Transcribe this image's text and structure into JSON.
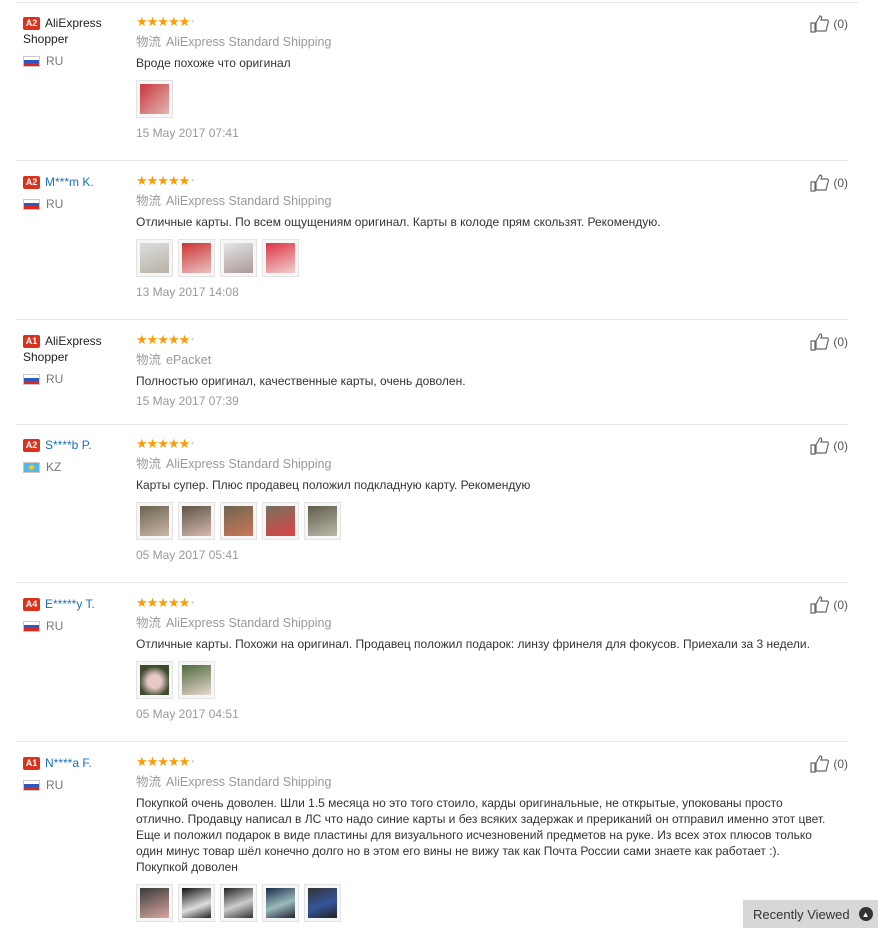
{
  "shipping_label": "物流",
  "recently_viewed": "Recently Viewed",
  "reviews": [
    {
      "badge": "A2",
      "name": "AliExpress Shopper",
      "country": "RU",
      "stars": "★★★★★",
      "shipping": "AliExpress Standard Shipping",
      "text": "Вроде похоже что оригинал",
      "date": "15 May 2017 07:41",
      "helpful": "(0)"
    },
    {
      "badge": "A2",
      "name": "M***m K.",
      "country": "RU",
      "stars": "★★★★★",
      "shipping": "AliExpress Standard Shipping",
      "text": "Отличные карты. По всем ощущениям оригинал. Карты в колоде прям скользят. Рекомендую.",
      "date": "13 May 2017 14:08",
      "helpful": "(0)"
    },
    {
      "badge": "A1",
      "name": "AliExpress Shopper",
      "country": "RU",
      "stars": "★★★★★",
      "shipping": "ePacket",
      "text": "Полностью оригинал, качественные карты, очень доволен.",
      "date": "15 May 2017 07:39",
      "helpful": "(0)"
    },
    {
      "badge": "A2",
      "name": "S****b P.",
      "country": "KZ",
      "stars": "★★★★★",
      "shipping": "AliExpress Standard Shipping",
      "text": "Карты супер. Плюс продавец положил подкладную карту. Рекомендую",
      "date": "05 May 2017 05:41",
      "helpful": "(0)"
    },
    {
      "badge": "A4",
      "name": "E*****y T.",
      "country": "RU",
      "stars": "★★★★★",
      "shipping": "AliExpress Standard Shipping",
      "text": "Отличные карты. Похожи на оригинал. Продавец положил подарок: линзу фринеля для фокусов. Приехали за 3 недели.",
      "date": "05 May 2017 04:51",
      "helpful": "(0)"
    },
    {
      "badge": "A1",
      "name": "N****a F.",
      "country": "RU",
      "stars": "★★★★★",
      "shipping": "AliExpress Standard Shipping",
      "text": "Покупкой очень доволен. Шли 1.5 месяца но это того стоило, карды оригинальные, не открытые, упокованы просто отлично. Продавцу написал в ЛС что надо синие карты и без всяких задержак и прериканий он отправил именно этот цвет. Еще и положил подарок в виде пластины для визуального исчезновений предметов на руке. Из всех этох плюсов только один минус товар шёл конечно долго но в этом его вины не вижу так как Почта России сами знаете как работает :). Покупкой доволен",
      "date": "",
      "helpful": "(0)"
    }
  ]
}
